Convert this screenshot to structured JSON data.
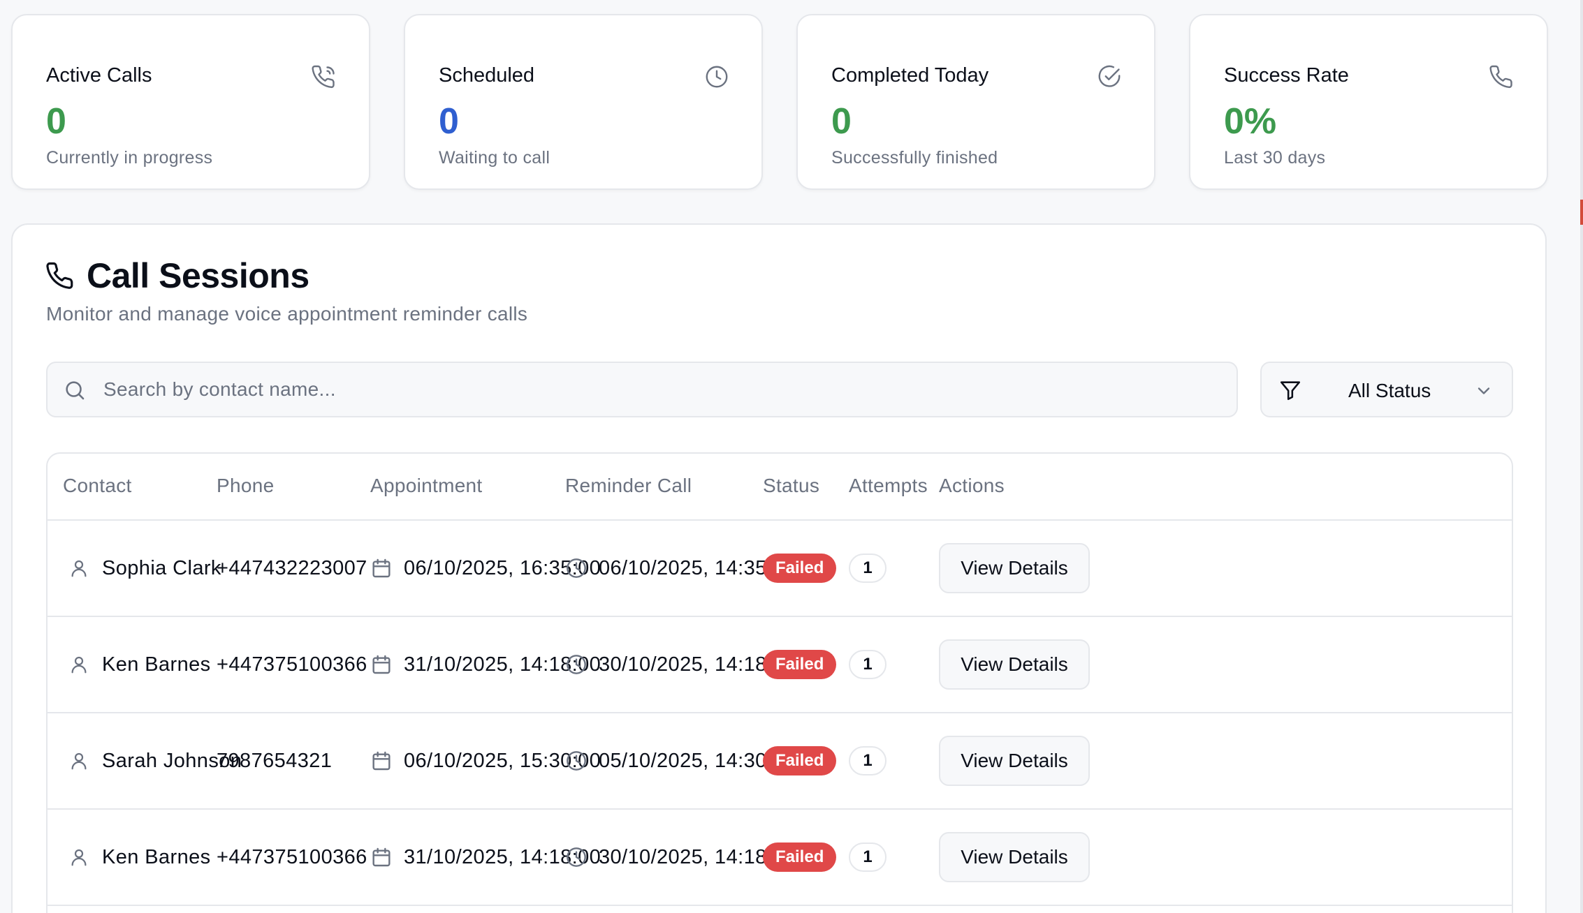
{
  "stats": [
    {
      "title": "Active Calls",
      "value": "0",
      "subtitle": "Currently in progress",
      "icon": "phone-call-icon",
      "color": "#3d9a4e"
    },
    {
      "title": "Scheduled",
      "value": "0",
      "subtitle": "Waiting to call",
      "icon": "clock-icon",
      "color": "#2f5fd0"
    },
    {
      "title": "Completed Today",
      "value": "0",
      "subtitle": "Successfully finished",
      "icon": "check-circle-icon",
      "color": "#3d9a4e"
    },
    {
      "title": "Success Rate",
      "value": "0%",
      "subtitle": "Last 30 days",
      "icon": "phone-icon",
      "color": "#3d9a4e"
    }
  ],
  "sessions": {
    "icon": "phone-icon",
    "title": "Call Sessions",
    "subtitle": "Monitor and manage voice appointment reminder calls",
    "search": {
      "placeholder": "Search by contact name...",
      "value": ""
    },
    "status_filter": {
      "selected": "All Status"
    },
    "table": {
      "columns": [
        "Contact",
        "Phone",
        "Appointment",
        "Reminder Call",
        "Status",
        "Attempts",
        "Actions"
      ],
      "rows": [
        {
          "contact": "Sophia Clark",
          "phone": "+447432223007",
          "appointment": "06/10/2025, 16:35:00",
          "reminder": "06/10/2025, 14:35:00",
          "status": "Failed",
          "attempts": "1",
          "action": "View Details"
        },
        {
          "contact": "Ken Barnes",
          "phone": "+447375100366",
          "appointment": "31/10/2025, 14:18:00",
          "reminder": "30/10/2025, 14:18:00",
          "status": "Failed",
          "attempts": "1",
          "action": "View Details"
        },
        {
          "contact": "Sarah Johnson",
          "phone": "7987654321",
          "appointment": "06/10/2025, 15:30:00",
          "reminder": "05/10/2025, 14:30:00",
          "status": "Failed",
          "attempts": "1",
          "action": "View Details"
        },
        {
          "contact": "Ken Barnes",
          "phone": "+447375100366",
          "appointment": "31/10/2025, 14:18:00",
          "reminder": "30/10/2025, 14:18:00",
          "status": "Failed",
          "attempts": "1",
          "action": "View Details"
        }
      ]
    }
  },
  "colors": {
    "failed": "#e04848",
    "border": "#e5e7eb",
    "muted_text": "#6b7280",
    "green": "#3d9a4e",
    "blue": "#2f5fd0"
  }
}
